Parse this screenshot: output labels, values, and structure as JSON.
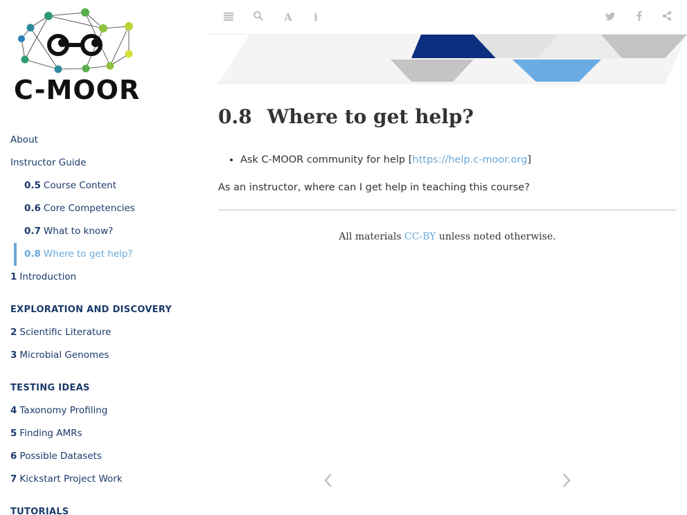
{
  "logo": {
    "text": "C-MOOR"
  },
  "sidebar": {
    "items": [
      {
        "num": "",
        "label": "About",
        "level": 0
      },
      {
        "num": "",
        "label": "Instructor Guide",
        "level": 0
      },
      {
        "num": "0.5",
        "label": "Course Content",
        "level": 1
      },
      {
        "num": "0.6",
        "label": "Core Competencies",
        "level": 1
      },
      {
        "num": "0.7",
        "label": "What to know?",
        "level": 1
      },
      {
        "num": "0.8",
        "label": "Where to get help?",
        "level": 1,
        "active": true
      },
      {
        "num": "1",
        "label": "Introduction",
        "level": 0
      }
    ],
    "section_exploration": "EXPLORATION AND DISCOVERY",
    "exploration_items": [
      {
        "num": "2",
        "label": "Scientific Literature"
      },
      {
        "num": "3",
        "label": "Microbial Genomes"
      }
    ],
    "section_testing": "TESTING IDEAS",
    "testing_items": [
      {
        "num": "4",
        "label": "Taxonomy Profiling"
      },
      {
        "num": "5",
        "label": "Finding AMRs"
      },
      {
        "num": "6",
        "label": "Possible Datasets"
      },
      {
        "num": "7",
        "label": "Kickstart Project Work"
      }
    ],
    "section_tutorials": "TUTORIALS"
  },
  "toolbar": {
    "left_icons": [
      "menu-icon",
      "search-icon",
      "font-icon",
      "info-icon"
    ],
    "right_icons": [
      "twitter-icon",
      "facebook-icon",
      "share-icon"
    ]
  },
  "page": {
    "section_number": "0.8",
    "title": "Where to get help?",
    "bullet_prefix": "Ask C-MOOR community for help [",
    "bullet_link": "https://help.c-moor.org",
    "bullet_suffix": "]",
    "paragraph": "As an instructor, where can I get help in teaching this course?"
  },
  "footer": {
    "prefix": "All materials ",
    "link": "CC-BY",
    "suffix": " unless noted otherwise."
  },
  "navigation": {
    "prev": "previous-page",
    "next": "next-page"
  },
  "colors": {
    "nav_text": "#1b3a6b",
    "accent": "#6aa8d8",
    "banner_dark": "#0b2f7e",
    "banner_light": "#6aace4"
  }
}
